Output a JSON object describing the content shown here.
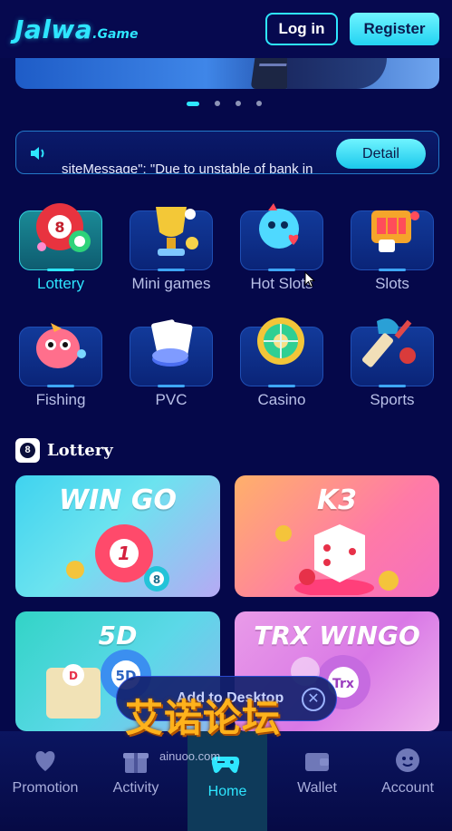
{
  "header": {
    "logo_main": "Jalwa",
    "logo_sub": ".Game",
    "login_label": "Log in",
    "register_label": "Register"
  },
  "carousel": {
    "slide_count": 4,
    "active_index": 0
  },
  "notice": {
    "icon": "speaker-icon",
    "text": "siteMessage\": \"Due to unstable of bank in",
    "detail_label": "Detail"
  },
  "categories": [
    {
      "label": "Lottery",
      "icon": "lottery-balls-icon",
      "active": true
    },
    {
      "label": "Mini games",
      "icon": "trophy-icon",
      "active": false
    },
    {
      "label": "Hot Slots",
      "icon": "hot-slots-icon",
      "active": false
    },
    {
      "label": "Slots",
      "icon": "slot-machine-icon",
      "active": false
    },
    {
      "label": "Fishing",
      "icon": "fish-icon",
      "active": false
    },
    {
      "label": "PVC",
      "icon": "cards-chips-icon",
      "active": false
    },
    {
      "label": "Casino",
      "icon": "roulette-icon",
      "active": false
    },
    {
      "label": "Sports",
      "icon": "cricket-icon",
      "active": false
    }
  ],
  "lottery_section": {
    "title": "Lottery",
    "icon_text": "8",
    "games": [
      {
        "title": "WIN GO",
        "ball_main": "1",
        "ball_small": "8"
      },
      {
        "title": "K3"
      },
      {
        "title": "5D",
        "ball_main": "5D",
        "ball_small": "D"
      },
      {
        "title": "TRX WINGO",
        "ball_main": "Trx"
      }
    ]
  },
  "overlay": {
    "promo_text": "Add to Desktop",
    "watermark_cn": "艾诺论坛",
    "watermark_url": "ainuoo.com"
  },
  "bottom_nav": [
    {
      "label": "Promotion",
      "icon": "promotion-icon"
    },
    {
      "label": "Activity",
      "icon": "gift-icon"
    },
    {
      "label": "Home",
      "icon": "gamepad-icon",
      "active": true
    },
    {
      "label": "Wallet",
      "icon": "wallet-icon"
    },
    {
      "label": "Account",
      "icon": "account-icon"
    }
  ],
  "colors": {
    "background": "#05084a",
    "accent": "#2ee6ff",
    "muted_text": "#b9c0e8"
  }
}
